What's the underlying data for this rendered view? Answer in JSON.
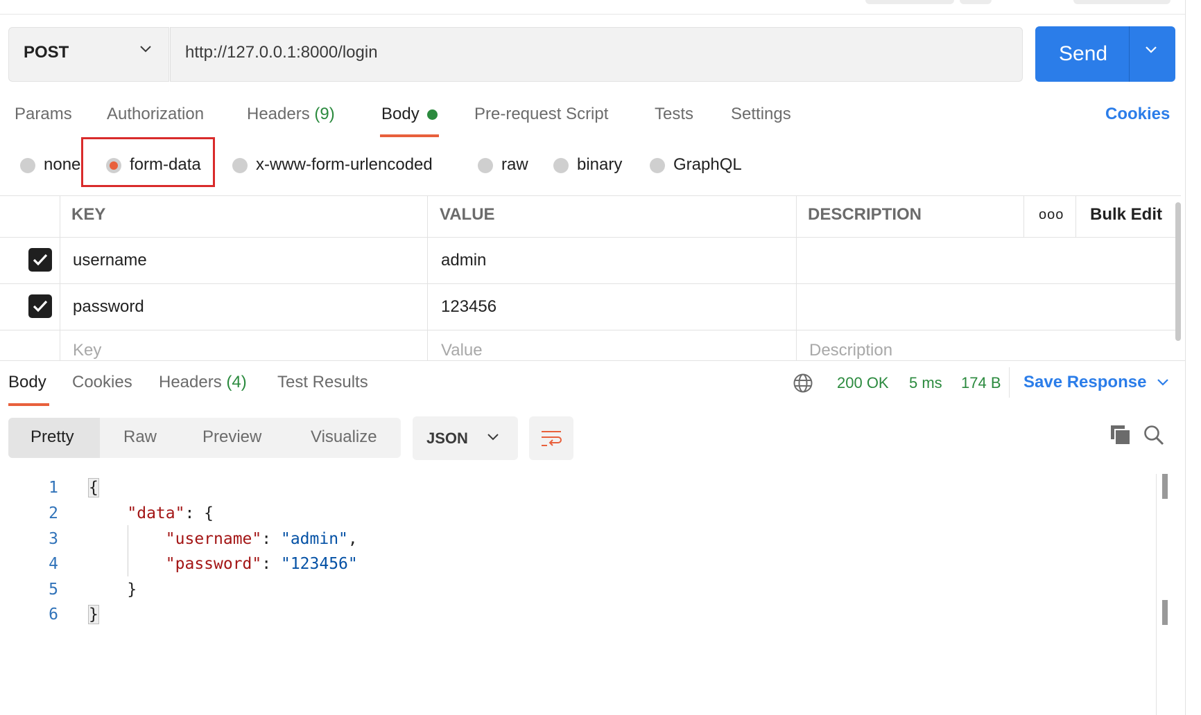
{
  "request": {
    "method": "POST",
    "url": "http://127.0.0.1:8000/login",
    "send_label": "Send"
  },
  "request_tabs": {
    "params": "Params",
    "authorization": "Authorization",
    "headers": "Headers",
    "headers_count": "(9)",
    "body": "Body",
    "prerequest": "Pre-request Script",
    "tests": "Tests",
    "settings": "Settings",
    "cookies": "Cookies"
  },
  "body_types": {
    "none": "none",
    "form_data": "form-data",
    "urlencoded": "x-www-form-urlencoded",
    "raw": "raw",
    "binary": "binary",
    "graphql": "GraphQL",
    "selected": "form-data"
  },
  "params_table": {
    "headers": {
      "key": "KEY",
      "value": "VALUE",
      "description": "DESCRIPTION",
      "bulk_edit": "Bulk Edit",
      "more": "ooo"
    },
    "rows": [
      {
        "key": "username",
        "value": "admin",
        "description": "",
        "enabled": true
      },
      {
        "key": "password",
        "value": "123456",
        "description": "",
        "enabled": true
      }
    ],
    "placeholders": {
      "key": "Key",
      "value": "Value",
      "description": "Description"
    }
  },
  "response": {
    "tabs": {
      "body": "Body",
      "cookies": "Cookies",
      "headers": "Headers",
      "headers_count": "(4)",
      "test_results": "Test Results"
    },
    "status": "200 OK",
    "time": "5 ms",
    "size": "174 B",
    "save_response": "Save Response",
    "view_modes": {
      "pretty": "Pretty",
      "raw": "Raw",
      "preview": "Preview",
      "visualize": "Visualize"
    },
    "format": "JSON",
    "code": {
      "line_numbers": [
        "1",
        "2",
        "3",
        "4",
        "5",
        "6"
      ],
      "open_brace": "{",
      "close_brace": "}",
      "data_key": "\"data\"",
      "username_key": "\"username\"",
      "username_value": "\"admin\"",
      "password_key": "\"password\"",
      "password_value": "\"123456\""
    }
  },
  "colors": {
    "accent": "#e8603c",
    "primary": "#2b7de9",
    "success": "#2b8a3e",
    "highlight_box": "#d92b2b"
  }
}
